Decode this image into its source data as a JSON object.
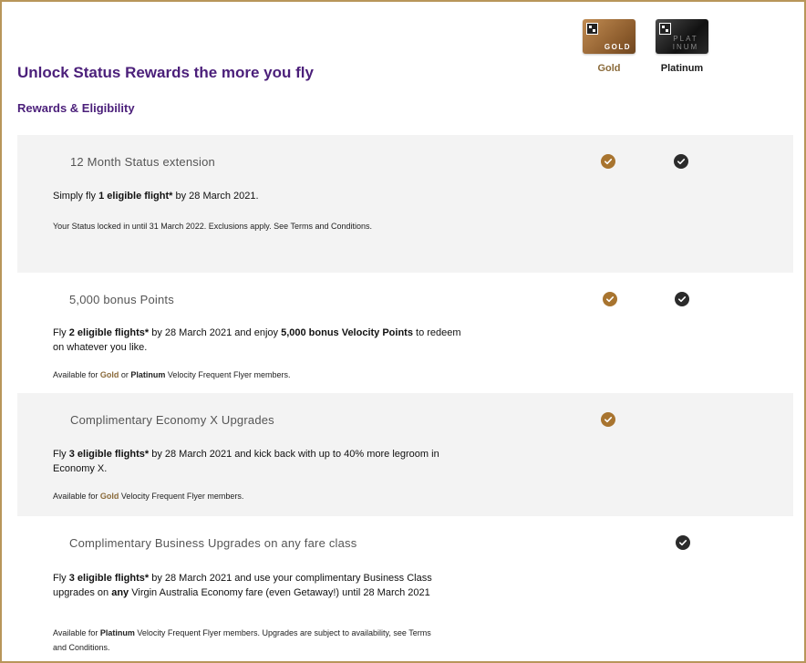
{
  "header": {
    "title": "Unlock Status Rewards the more you fly",
    "subtitle": "Rewards & Eligibility"
  },
  "tiers": {
    "gold": {
      "label": "Gold",
      "card_text": "GOLD",
      "color": "#a8742f"
    },
    "platinum": {
      "label": "Platinum",
      "card_text": "PLAT INUM",
      "color": "#2b2b2b"
    }
  },
  "rewards": [
    {
      "title": "12 Month Status extension",
      "body": {
        "p1": "Simply fly ",
        "b1": "1 eligible flight*",
        "p2": " by 28 March 2021."
      },
      "note": {
        "p1": "Your  Status locked in until 31 March 2022. Exclusions apply. See Terms and Conditions."
      },
      "gold": true,
      "platinum": true
    },
    {
      "title": "5,000 bonus Points",
      "body": {
        "p1": "Fly ",
        "b1": "2 eligible flights*",
        "p2": " by 28 March 2021 and enjoy ",
        "b2": "5,000 bonus Velocity Points",
        "p3": " to redeem on whatever you like."
      },
      "note": {
        "p1": "Available for ",
        "t1": "Gold",
        "p2": " or ",
        "b1": "Platinum",
        "p3": " Velocity Frequent Flyer members."
      },
      "gold": true,
      "platinum": true
    },
    {
      "title": "Complimentary Economy X Upgrades",
      "body": {
        "p1": "Fly ",
        "b1": "3 eligible flights*",
        "p2": " by 28 March 2021 and kick back with up to 40% more legroom in Economy X."
      },
      "note": {
        "p1": "Available for ",
        "t1": "Gold",
        "p2": " Velocity Frequent Flyer members."
      },
      "gold": true,
      "platinum": false
    },
    {
      "title": "Complimentary Business Upgrades on any fare class",
      "body": {
        "p1": "Fly ",
        "b1": "3 eligible flights*",
        "p2": " by 28 March 2021 and use your complimentary Business Class upgrades on ",
        "b2": "any",
        "p3": " Virgin Australia Economy fare (even Getaway!) until 28 March 2021"
      },
      "note": {
        "p1": "Available for ",
        "b1": "Platinum",
        "p2": " Velocity Frequent Flyer members. Upgrades are subject to availability, see Terms and Conditions."
      },
      "gold": false,
      "platinum": true
    }
  ]
}
